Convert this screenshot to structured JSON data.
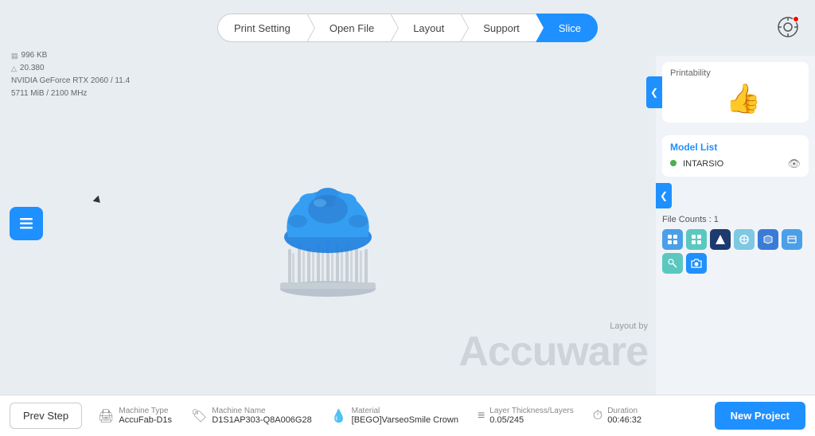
{
  "nav": {
    "steps": [
      {
        "id": "print-setting",
        "label": "Print Setting",
        "active": false
      },
      {
        "id": "open-file",
        "label": "Open File",
        "active": false
      },
      {
        "id": "layout",
        "label": "Layout",
        "active": false
      },
      {
        "id": "support",
        "label": "Support",
        "active": false
      },
      {
        "id": "slice",
        "label": "Slice",
        "active": true
      }
    ]
  },
  "system": {
    "memory": "996 KB",
    "temperature": "20.380",
    "gpu": "NVIDIA GeForce RTX 2060 / 11.4",
    "vram": "5711 MiB / 2100 MHz"
  },
  "printability": {
    "title": "Printability"
  },
  "model_list": {
    "title": "Model List",
    "items": [
      {
        "name": "INTARSIO",
        "visible": true
      }
    ]
  },
  "layout_by": "Layout by",
  "brand": "Accuware",
  "file_counts": "File Counts : 1",
  "status_bar": {
    "prev_label": "Prev Step",
    "machine_type_label": "Machine Type",
    "machine_type_value": "AccuFab-D1s",
    "machine_name_label": "Machine Name",
    "machine_name_value": "D1S1AP303-Q8A006G28",
    "material_label": "Material",
    "material_value": "[BEGO]VarseoSmile Crown",
    "layer_label": "Layer Thickness/Layers",
    "layer_value": "0.05/245",
    "duration_label": "Duration",
    "duration_value": "00:46:32",
    "new_project_label": "New Project"
  },
  "notification_dot": "red"
}
